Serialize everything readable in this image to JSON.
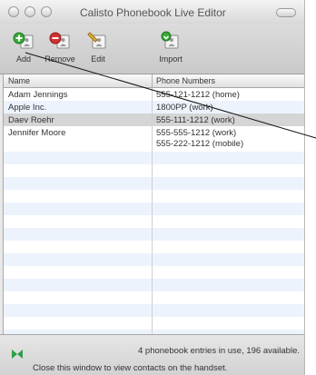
{
  "window": {
    "title": "Calisto Phonebook Live Editor"
  },
  "toolbar": {
    "add_label": "Add",
    "remove_label": "Remove",
    "edit_label": "Edit",
    "import_label": "Import"
  },
  "table": {
    "columns": [
      "Name",
      "Phone Numbers"
    ],
    "rows": [
      {
        "name": "Adam Jennings",
        "phones": [
          "555-121-1212 (home)"
        ]
      },
      {
        "name": "Apple Inc.",
        "phones": [
          "1800PP (work)"
        ]
      },
      {
        "name": "Daev Roehr",
        "phones": [
          "555-111-1212 (work)"
        ],
        "selected": true
      },
      {
        "name": "Jennifer Moore",
        "phones": [
          "555-555-1212 (work)",
          "555-222-1212 (mobile)"
        ]
      }
    ]
  },
  "status": {
    "count_text": "4 phonebook entries in use, 196 available.",
    "hint_text": "Close this window to view contacts on the handset.",
    "icon": "bluetooth-icon"
  },
  "colors": {
    "stripe": "#edf3fd",
    "selected_row": "#d5d5d5",
    "add_green": "#3aa63a",
    "remove_red": "#d23232",
    "bluetooth_green": "#2e9e4a"
  }
}
